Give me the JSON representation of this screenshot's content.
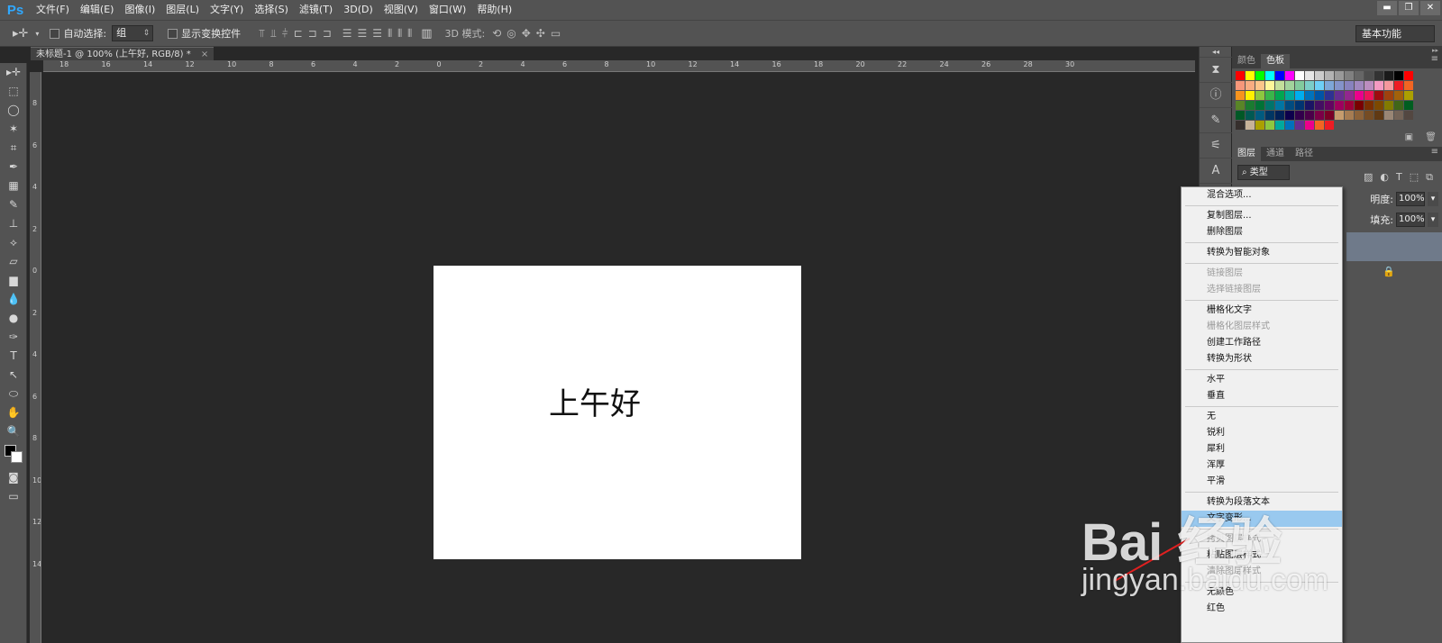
{
  "app": {
    "logo": "Ps"
  },
  "menu": [
    "文件(F)",
    "编辑(E)",
    "图像(I)",
    "图层(L)",
    "文字(Y)",
    "选择(S)",
    "滤镜(T)",
    "3D(D)",
    "视图(V)",
    "窗口(W)",
    "帮助(H)"
  ],
  "options": {
    "auto_select_label": "自动选择:",
    "auto_select_value": "组",
    "show_transform_label": "显示变换控件",
    "mode_3d_label": "3D 模式:",
    "workspace": "基本功能"
  },
  "document": {
    "tab_title": "未标题-1 @ 100% (上午好, RGB/8) *",
    "tab_close": "×",
    "text": "上午好"
  },
  "ruler_top": [
    "18",
    "16",
    "14",
    "12",
    "10",
    "8",
    "6",
    "4",
    "2",
    "0",
    "2",
    "4",
    "6",
    "8",
    "10",
    "12",
    "14",
    "16",
    "18",
    "20",
    "22",
    "24",
    "26",
    "28",
    "30"
  ],
  "ruler_left": [
    "8",
    "6",
    "4",
    "2",
    "0",
    "2",
    "4",
    "6",
    "8",
    "10",
    "12",
    "14"
  ],
  "panels": {
    "color_tab": "颜色",
    "swatches_tab": "色板",
    "layers_tab": "图层",
    "channels_tab": "通道",
    "paths_tab": "路径",
    "filter_kind": "类型",
    "opacity_label": "明度:",
    "opacity_value": "100%",
    "fill_label": "填充:",
    "fill_value": "100%"
  },
  "swatch_colors": [
    "#ff0000",
    "#ffff00",
    "#00ff00",
    "#00ffff",
    "#0000ff",
    "#ff00ff",
    "#ffffff",
    "#e6e6e6",
    "#cccccc",
    "#b3b3b3",
    "#999999",
    "#808080",
    "#666666",
    "#4d4d4d",
    "#333333",
    "#1a1a1a",
    "#000000",
    "#ff0000",
    "#f7977a",
    "#f9ad81",
    "#fdc68a",
    "#fff79a",
    "#c4df9b",
    "#a2d39c",
    "#82ca9d",
    "#7bcdc8",
    "#6ecff6",
    "#7ea7d8",
    "#8493ca",
    "#8882be",
    "#a187be",
    "#bc8dbf",
    "#f49ac2",
    "#f6989d",
    "#ed1c24",
    "#f26522",
    "#f7941d",
    "#fff200",
    "#8dc73f",
    "#39b54a",
    "#00a651",
    "#00a99d",
    "#00aeef",
    "#0072bc",
    "#0054a6",
    "#2e3192",
    "#662d91",
    "#92278f",
    "#ec008c",
    "#ed145b",
    "#9e0b0f",
    "#a0410d",
    "#a3620a",
    "#aba000",
    "#598527",
    "#1a7b30",
    "#007236",
    "#00746b",
    "#0076a3",
    "#004b80",
    "#003471",
    "#1b1464",
    "#440e62",
    "#630460",
    "#9e005d",
    "#9e0039",
    "#790000",
    "#7b2e00",
    "#7d4900",
    "#827b00",
    "#406618",
    "#005e20",
    "#005826",
    "#005952",
    "#005b7f",
    "#003663",
    "#002157",
    "#0d004c",
    "#32004b",
    "#4b0049",
    "#7b0046",
    "#7a0026",
    "#c69c6d",
    "#a67c52",
    "#8c6239",
    "#754c24",
    "#603913",
    "#998675",
    "#736357",
    "#534741",
    "#362f2d",
    "#c7b299",
    "#aba000",
    "#8dc73f",
    "#00a99d",
    "#0072bc",
    "#662d91",
    "#ec008c",
    "#f26522",
    "#ed1c24"
  ],
  "context_menu": [
    {
      "label": "混合选项...",
      "state": "normal"
    },
    {
      "sep": true
    },
    {
      "label": "复制图层...",
      "state": "normal"
    },
    {
      "label": "删除图层",
      "state": "normal"
    },
    {
      "sep": true
    },
    {
      "label": "转换为智能对象",
      "state": "normal"
    },
    {
      "sep": true
    },
    {
      "label": "链接图层",
      "state": "disabled"
    },
    {
      "label": "选择链接图层",
      "state": "disabled"
    },
    {
      "sep": true
    },
    {
      "label": "栅格化文字",
      "state": "normal"
    },
    {
      "label": "栅格化图层样式",
      "state": "disabled"
    },
    {
      "label": "创建工作路径",
      "state": "normal"
    },
    {
      "label": "转换为形状",
      "state": "normal"
    },
    {
      "sep": true
    },
    {
      "label": "水平",
      "state": "normal"
    },
    {
      "label": "垂直",
      "state": "normal"
    },
    {
      "sep": true
    },
    {
      "label": "无",
      "state": "normal"
    },
    {
      "label": "锐利",
      "state": "normal"
    },
    {
      "label": "犀利",
      "state": "normal"
    },
    {
      "label": "浑厚",
      "state": "normal"
    },
    {
      "label": "平滑",
      "state": "normal"
    },
    {
      "sep": true
    },
    {
      "label": "转换为段落文本",
      "state": "normal"
    },
    {
      "label": "文字变形...",
      "state": "hl"
    },
    {
      "sep": true
    },
    {
      "label": "拷贝图层样式",
      "state": "disabled"
    },
    {
      "label": "粘贴图层样式",
      "state": "normal"
    },
    {
      "label": "清除图层样式",
      "state": "disabled"
    },
    {
      "sep": true
    },
    {
      "label": "无颜色",
      "state": "normal"
    },
    {
      "label": "红色",
      "state": "normal"
    }
  ],
  "watermark": {
    "main": "Bai 经验",
    "sub": "jingyan.baidu.com"
  }
}
